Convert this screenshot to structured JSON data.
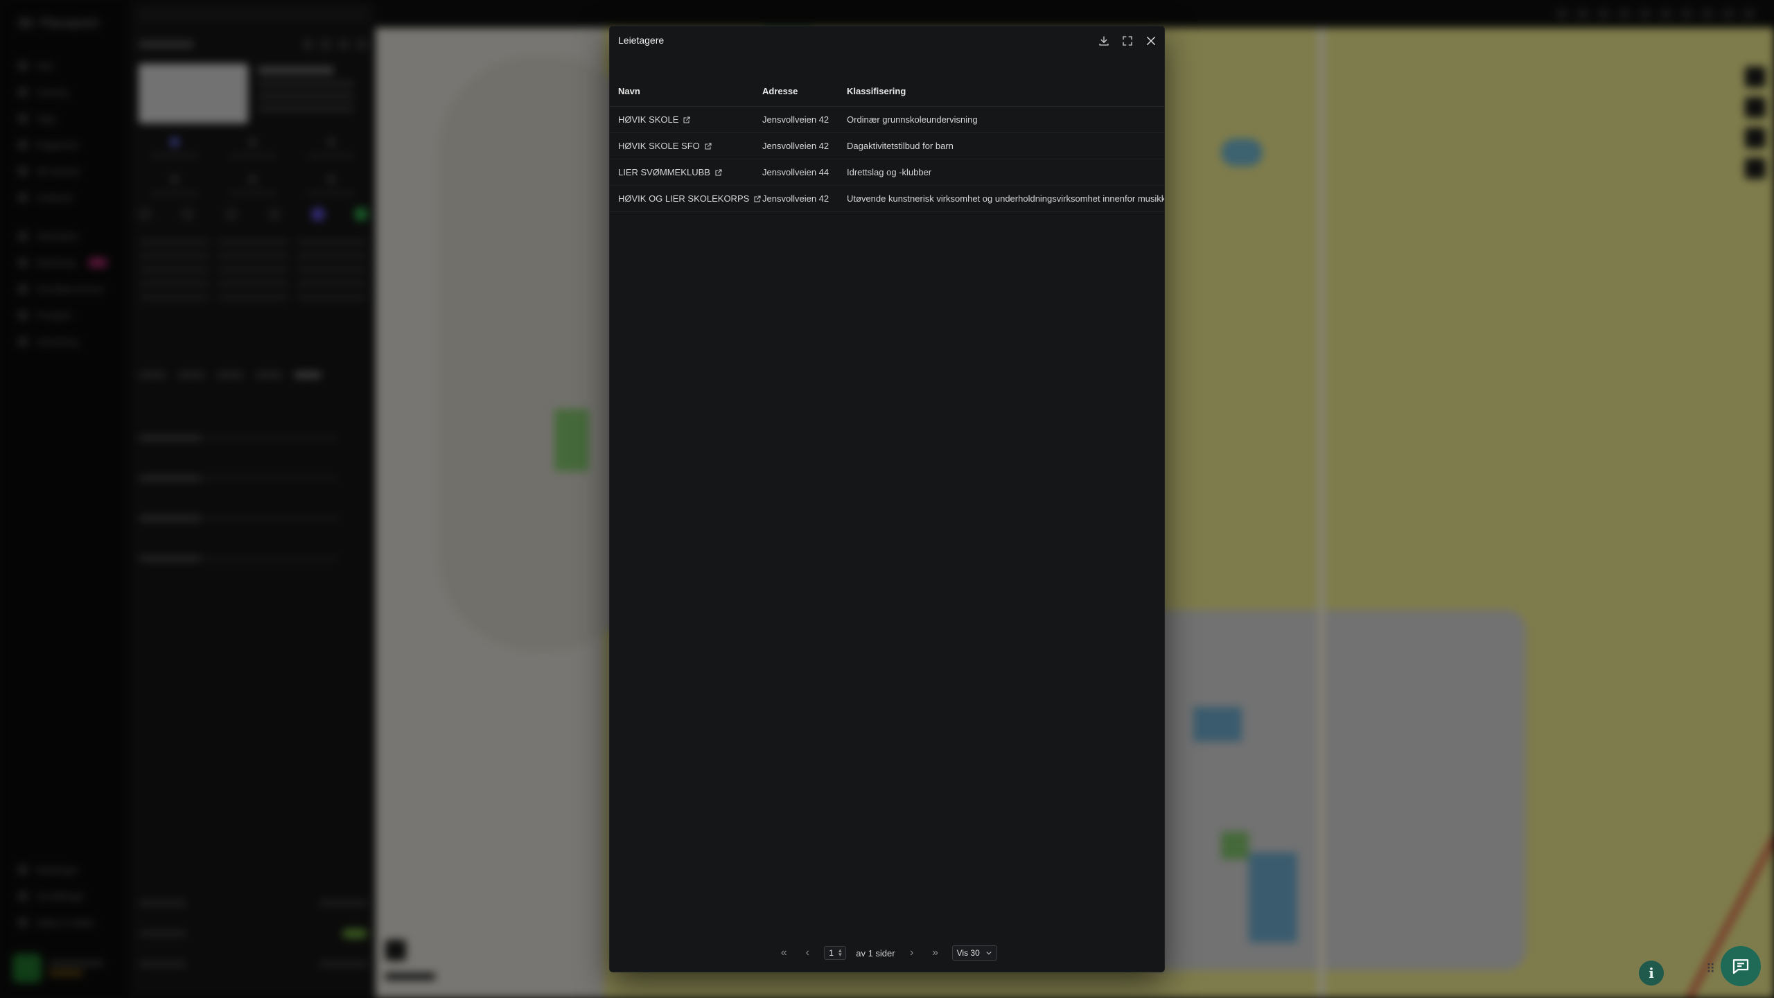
{
  "modal": {
    "title": "Leietagere",
    "actions": [
      {
        "icon": "download-icon"
      },
      {
        "icon": "fullscreen-icon"
      },
      {
        "icon": "close-icon"
      }
    ],
    "columns": {
      "name": "Navn",
      "address": "Adresse",
      "classification": "Klassifisering"
    },
    "rows": [
      {
        "name": "HØVIK SKOLE",
        "address": "Jensvollveien 42",
        "classification": "Ordinær grunnskoleundervisning"
      },
      {
        "name": "HØVIK SKOLE SFO",
        "address": "Jensvollveien 42",
        "classification": "Dagaktivitetstilbud for barn"
      },
      {
        "name": "LIER SVØMMEKLUBB",
        "address": "Jensvollveien 44",
        "classification": "Idrettslag og -klubber"
      },
      {
        "name": "HØVIK OG LIER SKOLEKORPS",
        "address": "Jensvollveien 42",
        "classification": "Utøvende kunstnerisk virksomhet og underholdningsvirksomhet innenfor musikk"
      }
    ],
    "pager": {
      "page": "1",
      "of_text": "av 1 sider",
      "per_page": "Vis 30"
    }
  },
  "background": {
    "brand": "Placepoint",
    "nav": [
      {
        "label": "Søk"
      },
      {
        "label": "Visning"
      },
      {
        "label": "Tags"
      },
      {
        "label": "Rapporter"
      },
      {
        "label": "3D-tekster"
      },
      {
        "label": "Analyser"
      },
      {
        "label": "Aktiviteter"
      },
      {
        "label": "Matching"
      },
      {
        "label": "Områderommer"
      },
      {
        "label": "Prosjekt"
      },
      {
        "label": "Utredning"
      }
    ],
    "nav_bottom": [
      {
        "label": "Meldinger"
      },
      {
        "label": "Innstillinger"
      },
      {
        "label": "Hjelp & støtte"
      }
    ],
    "panel_title": "Område"
  },
  "colors": {
    "modal_bg": "#151618",
    "accent_chat": "#1e6a57",
    "map_land": "#e6e28a"
  }
}
